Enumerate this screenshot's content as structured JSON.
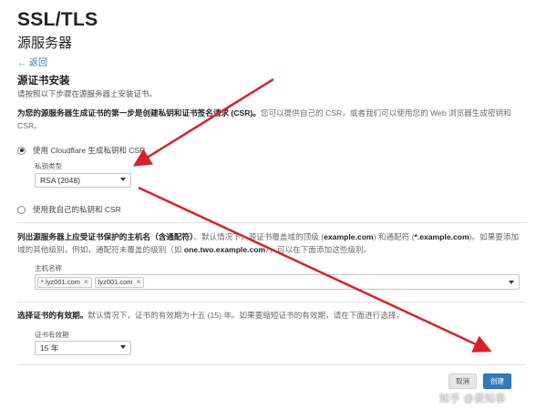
{
  "header": {
    "title": "SSL/TLS",
    "subtitle": "源服务器",
    "back_label": "返回"
  },
  "section_origin": {
    "title": "源证书安装",
    "description": "请按照以下步骤在源服务器上安装证书。",
    "intro_bold": "为您的源服务器生成证书的第一步是创建私钥和证书签名请求 (CSR)。",
    "intro_rest": "您可以提供自己的 CSR，或者我们可以使用您的 Web 浏览器生成密钥和 CSR。"
  },
  "key_options": {
    "option_generate": "使用 Cloudflare 生成私钥和 CSR",
    "option_own": "使用我自己的私钥和 CSR",
    "key_type_label": "私钥类型",
    "key_type_value": "RSA (2048)"
  },
  "hostnames": {
    "intro_bold": "列出源服务器上应受证书保护的主机名（含通配符）",
    "intro_p1": "。默认情况下，源证书覆盖域的顶级 (",
    "domain1": "example.com",
    "intro_p2": ") 和通配符 (",
    "domain2": "*.example.com",
    "intro_p3": ")。如果要添加域的其他级别，例如，通配符未覆盖的级别（如 ",
    "domain3": "one.two.example.com",
    "intro_p4": "），可以在下面添加这些级别。",
    "field_label": "主机名称",
    "tags": [
      "*.lyz001.com",
      "lyz001.com"
    ]
  },
  "validity": {
    "intro_bold": "选择证书的有效期。",
    "intro_rest": "默认情况下，证书的有效期为十五 (15) 年。如果要缩短证书的有效期，请在下面进行选择。",
    "field_label": "证书有效期",
    "value": "15 年"
  },
  "actions": {
    "cancel_label": "取消",
    "create_label": "创建"
  },
  "watermark": "知乎 @费知事",
  "colors": {
    "link": "#2c7cb0",
    "primary_button": "#2f7bbf",
    "annotation_arrow": "#d9202a"
  }
}
